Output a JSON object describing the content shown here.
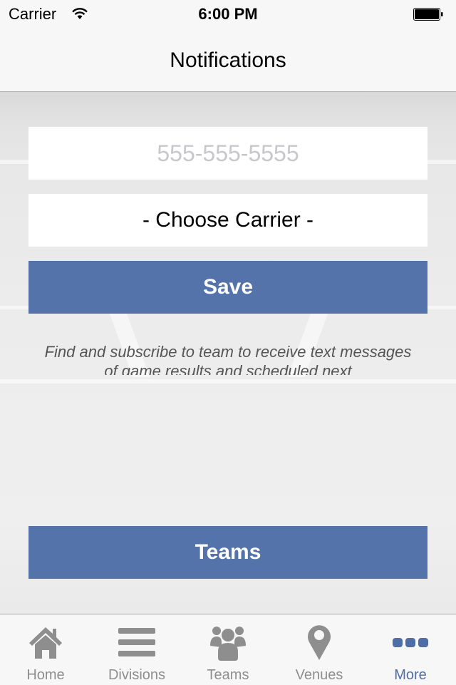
{
  "status_bar": {
    "carrier": "Carrier",
    "time": "6:00 PM",
    "wifi_icon": "wifi-icon",
    "battery_icon": "battery-full-icon"
  },
  "nav": {
    "title": "Notifications"
  },
  "form": {
    "phone_value": "",
    "phone_placeholder": "555-555-5555",
    "carrier_select": "- Choose Carrier -",
    "save_label": "Save",
    "info_text": "Find and subscribe to team to receive text messages of game results and scheduled next",
    "teams_label": "Teams"
  },
  "tabs": [
    {
      "label": "Home",
      "icon": "home-icon",
      "active": false
    },
    {
      "label": "Divisions",
      "icon": "list-icon",
      "active": false
    },
    {
      "label": "Teams",
      "icon": "group-icon",
      "active": false
    },
    {
      "label": "Venues",
      "icon": "map-pin-icon",
      "active": false
    },
    {
      "label": "More",
      "icon": "more-dots-icon",
      "active": true
    }
  ],
  "colors": {
    "accent": "#5373aa",
    "tab_active": "#4f6ea6",
    "tab_inactive": "#8e8e8e",
    "placeholder": "#c7c7cd"
  }
}
